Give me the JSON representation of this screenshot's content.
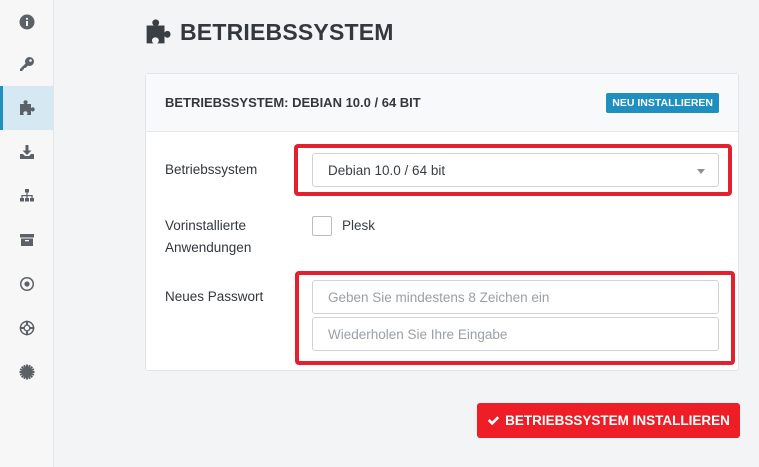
{
  "sidebar": {
    "items": [
      {
        "icon": "info-icon",
        "active": false
      },
      {
        "icon": "key-icon",
        "active": false
      },
      {
        "icon": "puzzle-icon",
        "active": true
      },
      {
        "icon": "download-icon",
        "active": false
      },
      {
        "icon": "sitemap-icon",
        "active": false
      },
      {
        "icon": "archive-icon",
        "active": false
      },
      {
        "icon": "target-icon",
        "active": false
      },
      {
        "icon": "lifebuoy-icon",
        "active": false
      },
      {
        "icon": "cog-icon",
        "active": false
      }
    ]
  },
  "page": {
    "title": "BETRIEBSSYSTEM",
    "title_icon": "puzzle-icon"
  },
  "card": {
    "header_title": "BETRIEBSSYSTEM: DEBIAN 10.0 / 64 BIT",
    "reinstall_label": "NEU INSTALLIEREN",
    "os_label": "Betriebssystem",
    "os_selected": "Debian 10.0 / 64 bit",
    "apps_label_line1": "Vorinstallierte",
    "apps_label_line2": "Anwendungen",
    "plesk_label": "Plesk",
    "plesk_checked": false,
    "password_label": "Neues Passwort",
    "password_placeholder": "Geben Sie mindestens 8 Zeichen ein",
    "password_repeat_placeholder": "Wiederholen Sie Ihre Eingabe"
  },
  "actions": {
    "install_label": "BETRIEBSSYSTEM INSTALLIEREN",
    "install_icon": "check-icon"
  },
  "colors": {
    "accent": "#1e8fbf",
    "danger": "#ef1d25",
    "highlight": "#e3202d"
  }
}
